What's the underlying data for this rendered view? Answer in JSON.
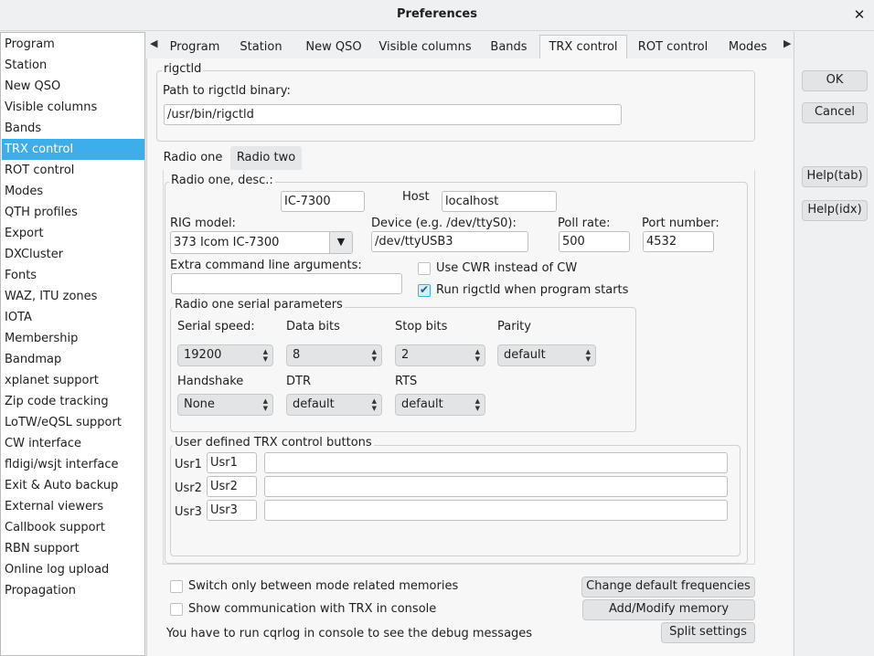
{
  "window": {
    "title": "Preferences",
    "close_glyph": "✕"
  },
  "sidebar": {
    "items": [
      "Program",
      "Station",
      "New QSO",
      "Visible columns",
      "Bands",
      "TRX control",
      "ROT control",
      "Modes",
      "QTH profiles",
      "Export",
      "DXCluster",
      "Fonts",
      "WAZ, ITU zones",
      "IOTA",
      "Membership",
      "Bandmap",
      "xplanet support",
      "Zip code tracking",
      "LoTW/eQSL support",
      "CW interface",
      "fldigi/wsjt interface",
      "Exit & Auto backup",
      "External viewers",
      "Callbook support",
      "RBN support",
      "Online log upload",
      "Propagation"
    ],
    "selected": "TRX control"
  },
  "tabs": {
    "left_arrow": "◀",
    "right_arrow": "▶",
    "items": [
      "Program",
      "Station",
      "New QSO",
      "Visible columns",
      "Bands",
      "TRX control",
      "ROT control",
      "Modes"
    ],
    "active": "TRX control"
  },
  "rigctld": {
    "group_title": "rigctld",
    "path_label": "Path to rigctld binary:",
    "path_value": "/usr/bin/rigctld"
  },
  "radio_tabs": {
    "one": "Radio one",
    "two": "Radio two"
  },
  "radio_one": {
    "desc_label": "Radio one, desc.:",
    "desc_value": "IC-7300",
    "host_label": "Host",
    "host_value": "localhost",
    "rig_model_label": "RIG model:",
    "rig_model_value": "373 Icom IC-7300",
    "device_label": "Device (e.g. /dev/ttyS0):",
    "device_value": "/dev/ttyUSB3",
    "poll_label": "Poll rate:",
    "poll_value": "500",
    "port_label": "Port number:",
    "port_value": "4532",
    "extra_label": "Extra command line arguments:",
    "extra_value": "",
    "cwr_label": "Use CWR instead of CW",
    "cwr_checked": false,
    "run_label": "Run rigctld when program starts",
    "run_checked": true
  },
  "serial": {
    "group_title": "Radio one serial parameters",
    "speed_label": "Serial speed:",
    "speed_value": "19200",
    "data_label": "Data bits",
    "data_value": "8",
    "stop_label": "Stop bits",
    "stop_value": "2",
    "parity_label": "Parity",
    "parity_value": "default",
    "handshake_label": "Handshake",
    "handshake_value": "None",
    "dtr_label": "DTR",
    "dtr_value": "default",
    "rts_label": "RTS",
    "rts_value": "default",
    "spin_up": "▲",
    "spin_down": "▼"
  },
  "user_buttons": {
    "group_title": "User defined TRX control buttons",
    "rows": [
      {
        "label": "Usr1",
        "name": "Usr1",
        "command": ""
      },
      {
        "label": "Usr2",
        "name": "Usr2",
        "command": ""
      },
      {
        "label": "Usr3",
        "name": "Usr3",
        "command": ""
      }
    ]
  },
  "bottom": {
    "switch_label": "Switch only between mode related memories",
    "show_label": "Show communication with TRX in console",
    "debug_note": "You have to run cqrlog in console to see the debug messages",
    "change_freq_button": "Change default frequencies",
    "add_memory_button": "Add/Modify memory",
    "split_button": "Split settings"
  },
  "side_buttons": {
    "ok": "OK",
    "cancel": "Cancel",
    "help_tab": "Help(tab)",
    "help_idx": "Help(idx)"
  },
  "combo_arrow": "▼"
}
